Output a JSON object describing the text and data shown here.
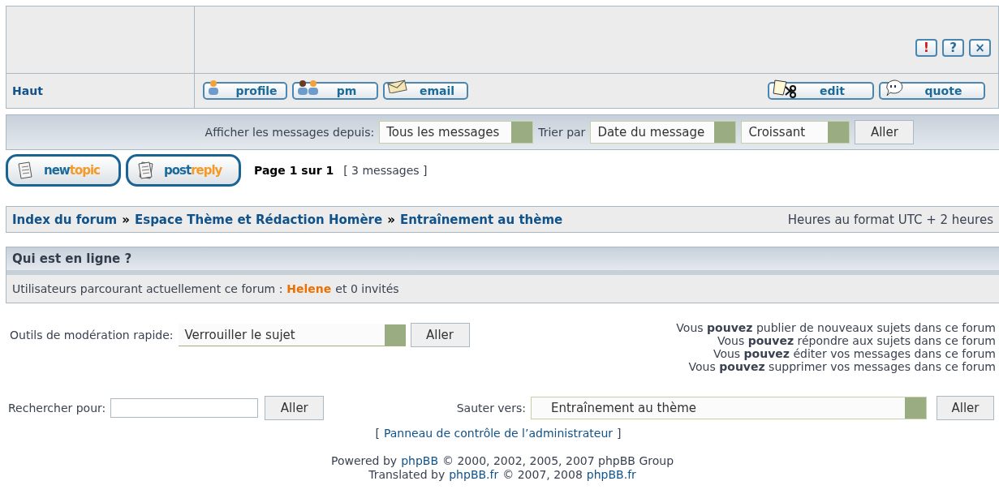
{
  "post": {
    "top_link": "Haut",
    "action_icons": [
      {
        "kind": "report",
        "glyph": "!"
      },
      {
        "kind": "info",
        "glyph": "?"
      },
      {
        "kind": "delete",
        "glyph": "×"
      }
    ],
    "left_buttons": [
      {
        "kind": "profile",
        "label": "profile"
      },
      {
        "kind": "pm",
        "label": "pm"
      },
      {
        "kind": "email",
        "label": "email"
      }
    ],
    "right_buttons": [
      {
        "kind": "edit",
        "label": "edit"
      },
      {
        "kind": "quote",
        "label": "quote"
      }
    ]
  },
  "sort_bar": {
    "display_label": "Afficher les messages depuis:",
    "display_value": "Tous les messages",
    "sort_label": "Trier par",
    "sort_value": "Date du message",
    "order_value": "Croissant",
    "button": "Aller"
  },
  "topic_buttons": [
    {
      "kind": "new",
      "parts": [
        "new",
        "topic"
      ]
    },
    {
      "kind": "reply",
      "parts": [
        "post",
        "reply"
      ]
    }
  ],
  "pagination": {
    "page": "Page 1 sur 1",
    "count": "[ 3 messages ]"
  },
  "breadcrumbs": [
    {
      "label": "Index du forum"
    },
    {
      "separator": "»",
      "label": "Espace Thème et Rédaction Homère"
    },
    {
      "separator": "»",
      "label": "Entraînement au thème"
    }
  ],
  "timezone": "Heures au format UTC + 2 heures",
  "online": {
    "title": "Qui est en ligne ?",
    "prefix": "Utilisateurs parcourant actuellement ce forum :",
    "user": "Helene",
    "suffix": "et 0 invités"
  },
  "moderation": {
    "label": "Outils de modération rapide:",
    "value": "Verrouiller le sujet",
    "button": "Aller"
  },
  "permissions": [
    "Vous **pouvez** publier de nouveaux sujets dans ce forum",
    "Vous **pouvez** répondre aux sujets dans ce forum",
    "Vous **pouvez** éditer vos messages dans ce forum",
    "Vous **pouvez** supprimer vos messages dans ce forum"
  ],
  "search": {
    "label": "Rechercher pour:",
    "button": "Aller"
  },
  "jump": {
    "label": "Sauter vers:",
    "value": "Entraînement au thème",
    "button": "Aller"
  },
  "admin": {
    "open": "[",
    "link": "Panneau de contrôle de l’administrateur",
    "close": "]"
  },
  "footer": [
    {
      "before": "Powered by",
      "link": "phpBB",
      "after": "© 2000, 2002, 2005, 2007 phpBB Group"
    },
    {
      "before": "Translated by",
      "link": "phpBB.fr",
      "after": "© 2007, 2008",
      "link2": "phpBB.fr"
    }
  ]
}
